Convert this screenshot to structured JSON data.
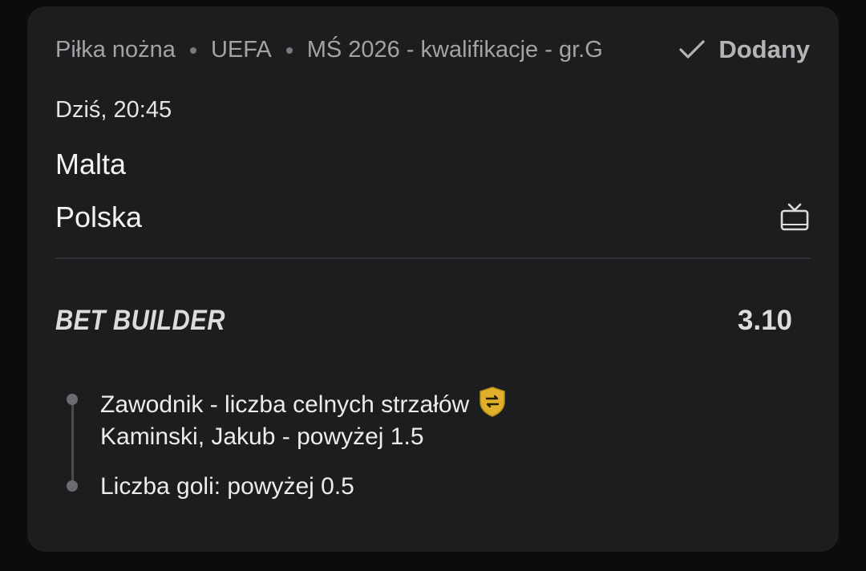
{
  "breadcrumb": {
    "sport": "Piłka nożna",
    "region": "UEFA",
    "competition": "MŚ 2026 - kwalifikacje - gr.G"
  },
  "status": {
    "label": "Dodany",
    "icon": "check-icon"
  },
  "event": {
    "datetime": "Dziś, 20:45",
    "home_team": "Malta",
    "away_team": "Polska",
    "tv_icon": "tv-icon"
  },
  "bet": {
    "type_label": "BET BUILDER",
    "odds": "3.10",
    "selections": [
      {
        "market": "Zawodnik - liczba celnych strzałów",
        "badge_icon": "swap-shield-icon",
        "badge_color": "#e0b02a",
        "pick": "Kaminski, Jakub - powyżej 1.5"
      },
      {
        "market": "Liczba goli: powyżej 0.5"
      }
    ]
  },
  "colors": {
    "background": "#0c0c0d",
    "card": "#1c1d1f",
    "muted_text": "#a3a3a6",
    "primary_text": "#f2f2f3"
  }
}
